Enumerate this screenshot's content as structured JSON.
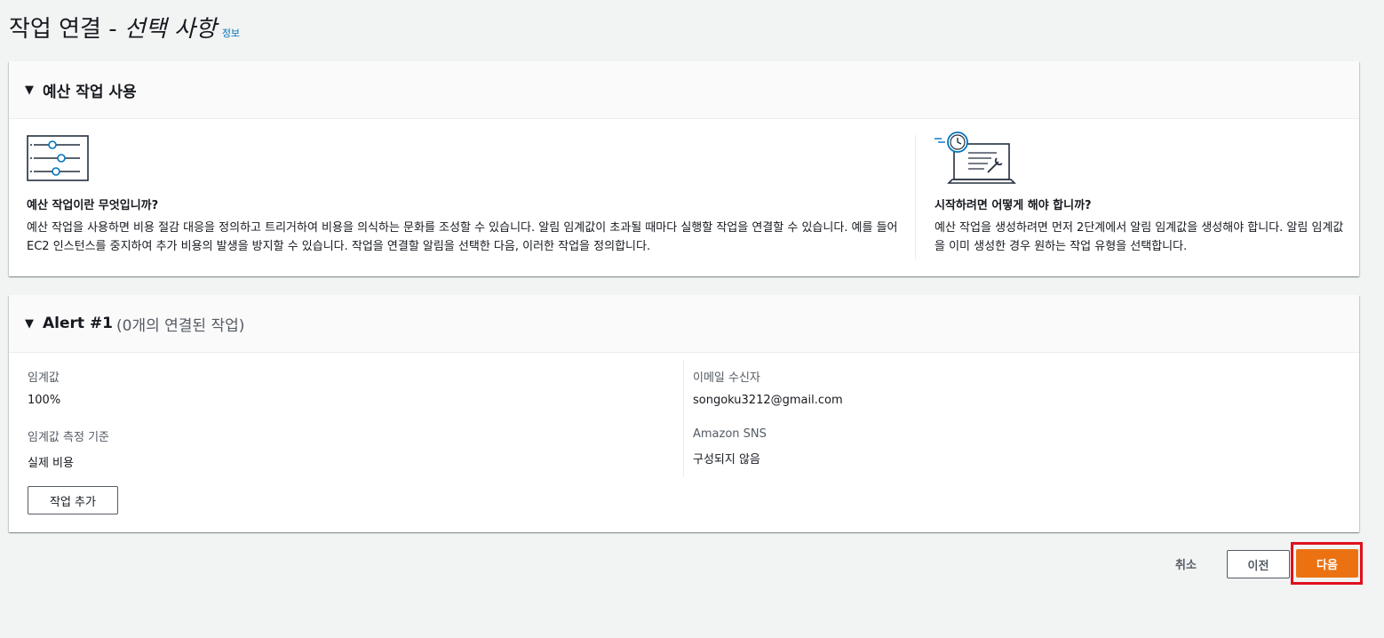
{
  "header": {
    "title_main": "작업 연결 - ",
    "title_optional": "선택 사항",
    "info_link": "정보"
  },
  "budget_actions_panel": {
    "title": "예산 작업 사용",
    "left": {
      "icon": "sliders-settings-icon",
      "heading": "예산 작업이란 무엇입니까?",
      "body": "예산 작업을 사용하면 비용 절감 대응을 정의하고 트리거하여 비용을 의식하는 문화를 조성할 수 있습니다. 알림 임계값이 초과될 때마다 실행할 작업을 연결할 수 있습니다. 예를 들어 EC2 인스턴스를 중지하여 추가 비용의 발생을 방지할 수 있습니다. 작업을 연결할 알림을 선택한 다음, 이러한 작업을 정의합니다."
    },
    "right": {
      "icon": "laptop-clock-wrench-icon",
      "heading": "시작하려면 어떻게 해야 합니까?",
      "body": "예산 작업을 생성하려면 먼저 2단계에서 알림 임계값을 생성해야 합니다. 알림 임계값을 이미 생성한 경우 원하는 작업 유형을 선택합니다."
    }
  },
  "alert_panel": {
    "title": "Alert #1",
    "subtitle": "(0개의 연결된 작업)",
    "threshold_label": "임계값",
    "threshold_value": "100%",
    "threshold_basis_label": "임계값 측정 기준",
    "threshold_basis_value": "실제 비용",
    "email_label": "이메일 수신자",
    "email_value": "songoku3212@gmail.com",
    "sns_label": "Amazon SNS",
    "sns_value": "구성되지 않음",
    "add_action_button": "작업 추가"
  },
  "footer": {
    "cancel": "취소",
    "previous": "이전",
    "next": "다음"
  },
  "colors": {
    "primary": "#ec7211",
    "link": "#0073bb",
    "highlight": "#e0101c"
  }
}
